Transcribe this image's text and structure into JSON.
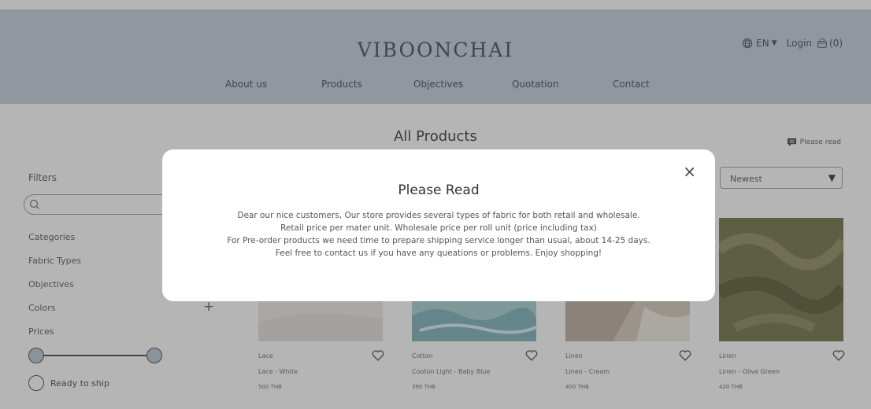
{
  "header": {
    "brand": "VIBOONCHAI",
    "language": "EN",
    "login_label": "Login",
    "cart_count": "(0)",
    "nav": [
      "About us",
      "Products",
      "Objectives",
      "Quotation",
      "Contact"
    ]
  },
  "main": {
    "title": "All Products",
    "please_read_link": "Please read"
  },
  "filters": {
    "label": "Filters",
    "search_placeholder": "",
    "categories": [
      "Categories",
      "Fabric Types",
      "Objectives",
      "Colors",
      "Prices"
    ],
    "ready_to_ship": "Ready to ship"
  },
  "sort": {
    "selected": "Newest"
  },
  "products": [
    {
      "category": "Lace",
      "name": "Lace - White",
      "price": "500 THB"
    },
    {
      "category": "Cotton",
      "name": "Cooton Light - Baby Blue",
      "price": "390 THB"
    },
    {
      "category": "Linen",
      "name": "Linen - Cream",
      "price": "400 THB"
    },
    {
      "category": "Linen",
      "name": "Linen - Olive Green",
      "price": "420 THB"
    }
  ],
  "modal": {
    "title": "Please Read",
    "close_symbol": "×",
    "lines": [
      "Dear our nice customers, Our store provides several types of fabric for both retail and wholesale.",
      "Retail price per mater unit. Wholesale price per roll unit (price including tax)",
      "For Pre-order products we need time to prepare shipping service longer than usual, about 14-25 days.",
      "Feel free to contact us if you have any queations or problems. Enjoy shopping!"
    ]
  },
  "colors": {
    "header_bg": "#c4cedb",
    "overlay": "rgba(70,70,70,0.4)",
    "slider_knob": "#b9c6d3"
  }
}
